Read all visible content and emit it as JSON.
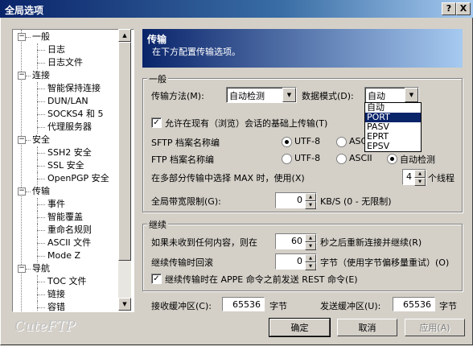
{
  "window": {
    "title": "全局选项",
    "help_btn": "?",
    "close_btn": "X"
  },
  "tree": {
    "items": [
      {
        "label": "一般",
        "level": 0,
        "expander": "−"
      },
      {
        "label": "日志",
        "level": 1
      },
      {
        "label": "日志文件",
        "level": 1
      },
      {
        "label": "连接",
        "level": 0,
        "expander": "−"
      },
      {
        "label": "智能保持连接",
        "level": 1
      },
      {
        "label": "DUN/LAN",
        "level": 1
      },
      {
        "label": "SOCKS4 和 5",
        "level": 1
      },
      {
        "label": "代理服务器",
        "level": 1
      },
      {
        "label": "安全",
        "level": 0,
        "expander": "−"
      },
      {
        "label": "SSH2 安全",
        "level": 1
      },
      {
        "label": "SSL 安全",
        "level": 1
      },
      {
        "label": "OpenPGP 安全",
        "level": 1
      },
      {
        "label": "传输",
        "level": 0,
        "expander": "−"
      },
      {
        "label": "事件",
        "level": 1
      },
      {
        "label": "智能覆盖",
        "level": 1
      },
      {
        "label": "重命名规则",
        "level": 1
      },
      {
        "label": "ASCII 文件",
        "level": 1
      },
      {
        "label": "Mode Z",
        "level": 1
      },
      {
        "label": "导航",
        "level": 0,
        "expander": "−"
      },
      {
        "label": "TOC 文件",
        "level": 1
      },
      {
        "label": "链接",
        "level": 1
      },
      {
        "label": "容错",
        "level": 1
      }
    ]
  },
  "header": {
    "title": "传输",
    "subtitle": "在下方配置传输选项。"
  },
  "general": {
    "group_label": "一般",
    "transfer_method_label": "传输方法(M):",
    "transfer_method_value": "自动检测",
    "data_mode_label": "数据模式(D):",
    "data_mode_value": "自动",
    "data_mode_options": [
      "自动",
      "PORT",
      "PASV",
      "EPRT",
      "EPSV"
    ],
    "data_mode_highlighted": "PORT",
    "allow_existing_label": "允许在现有（浏览）会话的基础上传输(T)",
    "sftp_label": "SFTP 档案名称编",
    "ftp_label": "FTP 档案名称编",
    "utf8": "UTF-8",
    "ascii": "ASCII",
    "auto_detect": "自动检测",
    "max_label": "在多部分传输中选择 MAX 时，使用(X)",
    "max_value": "4",
    "max_unit": "个线程",
    "bandwidth_label": "全局带宽限制(G):",
    "bandwidth_value": "0",
    "bandwidth_unit": "KB/S (0 - 无限制)"
  },
  "resume": {
    "group_label": "继续",
    "no_content_label": "如果未收到任何内容，则在",
    "no_content_value": "60",
    "no_content_unit": "秒之后重新连接并继续(R)",
    "rollback_label": "继续传输时回滚",
    "rollback_value": "0",
    "rollback_unit": "字节（使用字节偏移量重试）(O)",
    "rest_label": "继续传输时在 APPE 命令之前发送 REST 命令(E)"
  },
  "buffers": {
    "recv_label": "接收缓冲区(C):",
    "recv_value": "65536",
    "recv_unit": "字节",
    "send_label": "发送缓冲区(U):",
    "send_value": "65536",
    "send_unit": "字节"
  },
  "buttons": {
    "ok": "确定",
    "cancel": "取消",
    "apply": "应用(A)"
  },
  "logo": "CuteFTP"
}
